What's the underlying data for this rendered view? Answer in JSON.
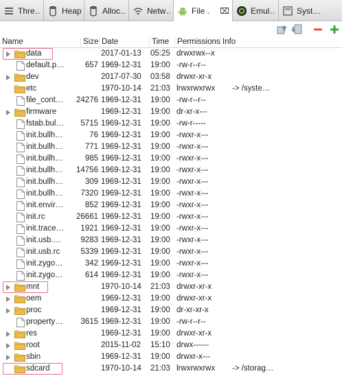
{
  "tabs": [
    {
      "label": "Thre…",
      "icon": "threads-icon"
    },
    {
      "label": "Heap",
      "icon": "heap-icon"
    },
    {
      "label": "Alloc…",
      "icon": "allocation-icon"
    },
    {
      "label": "Netw…",
      "icon": "network-icon"
    },
    {
      "label": "File …",
      "icon": "android-icon",
      "close": "⌧"
    },
    {
      "label": "Emul…",
      "icon": "emulator-icon"
    },
    {
      "label": "Syst…",
      "icon": "system-icon"
    }
  ],
  "header": {
    "name": "Name",
    "size": "Size",
    "date": "Date",
    "time": "Time",
    "permissions": "Permissions",
    "info": "Info"
  },
  "rows": [
    {
      "name": "data",
      "size": "",
      "date": "2017-01-13",
      "time": "05:25",
      "perm": "drwxrwx--x",
      "info": "",
      "type": "folder",
      "expandable": true,
      "highlighted": true
    },
    {
      "name": "default.p…",
      "size": "657",
      "date": "1969-12-31",
      "time": "19:00",
      "perm": "-rw-r--r--",
      "info": "",
      "type": "file"
    },
    {
      "name": "dev",
      "size": "",
      "date": "2017-07-30",
      "time": "03:58",
      "perm": "drwxr-xr-x",
      "info": "",
      "type": "folder",
      "expandable": true
    },
    {
      "name": "etc",
      "size": "",
      "date": "1970-10-14",
      "time": "21:03",
      "perm": "lrwxrwxrwx",
      "info": "-> /syste…",
      "type": "folder",
      "expandable": false
    },
    {
      "name": "file_cont…",
      "size": "24276",
      "date": "1969-12-31",
      "time": "19:00",
      "perm": "-rw-r--r--",
      "info": "",
      "type": "file"
    },
    {
      "name": "firmware",
      "size": "",
      "date": "1969-12-31",
      "time": "19:00",
      "perm": "dr-xr-x---",
      "info": "",
      "type": "folder",
      "expandable": true
    },
    {
      "name": "fstab.bul…",
      "size": "5715",
      "date": "1969-12-31",
      "time": "19:00",
      "perm": "-rw-r-----",
      "info": "",
      "type": "file"
    },
    {
      "name": "init.bullh…",
      "size": "76",
      "date": "1969-12-31",
      "time": "19:00",
      "perm": "-rwxr-x---",
      "info": "",
      "type": "file"
    },
    {
      "name": "init.bullh…",
      "size": "771",
      "date": "1969-12-31",
      "time": "19:00",
      "perm": "-rwxr-x---",
      "info": "",
      "type": "file"
    },
    {
      "name": "init.bullh…",
      "size": "985",
      "date": "1969-12-31",
      "time": "19:00",
      "perm": "-rwxr-x---",
      "info": "",
      "type": "file"
    },
    {
      "name": "init.bullh…",
      "size": "14756",
      "date": "1969-12-31",
      "time": "19:00",
      "perm": "-rwxr-x---",
      "info": "",
      "type": "file"
    },
    {
      "name": "init.bullh…",
      "size": "309",
      "date": "1969-12-31",
      "time": "19:00",
      "perm": "-rwxr-x---",
      "info": "",
      "type": "file"
    },
    {
      "name": "init.bullh…",
      "size": "7320",
      "date": "1969-12-31",
      "time": "19:00",
      "perm": "-rwxr-x---",
      "info": "",
      "type": "file"
    },
    {
      "name": "init.envir…",
      "size": "852",
      "date": "1969-12-31",
      "time": "19:00",
      "perm": "-rwxr-x---",
      "info": "",
      "type": "file"
    },
    {
      "name": "init.rc",
      "size": "26661",
      "date": "1969-12-31",
      "time": "19:00",
      "perm": "-rwxr-x---",
      "info": "",
      "type": "file"
    },
    {
      "name": "init.trace…",
      "size": "1921",
      "date": "1969-12-31",
      "time": "19:00",
      "perm": "-rwxr-x---",
      "info": "",
      "type": "file"
    },
    {
      "name": "init.usb.…",
      "size": "9283",
      "date": "1969-12-31",
      "time": "19:00",
      "perm": "-rwxr-x---",
      "info": "",
      "type": "file"
    },
    {
      "name": "init.usb.rc",
      "size": "5339",
      "date": "1969-12-31",
      "time": "19:00",
      "perm": "-rwxr-x---",
      "info": "",
      "type": "file"
    },
    {
      "name": "init.zygo…",
      "size": "342",
      "date": "1969-12-31",
      "time": "19:00",
      "perm": "-rwxr-x---",
      "info": "",
      "type": "file"
    },
    {
      "name": "init.zygo…",
      "size": "614",
      "date": "1969-12-31",
      "time": "19:00",
      "perm": "-rwxr-x---",
      "info": "",
      "type": "file"
    },
    {
      "name": "mnt",
      "size": "",
      "date": "1970-10-14",
      "time": "21:03",
      "perm": "drwxr-xr-x",
      "info": "",
      "type": "folder",
      "expandable": true,
      "highlighted": true
    },
    {
      "name": "oem",
      "size": "",
      "date": "1969-12-31",
      "time": "19:00",
      "perm": "drwxr-xr-x",
      "info": "",
      "type": "folder",
      "expandable": true
    },
    {
      "name": "proc",
      "size": "",
      "date": "1969-12-31",
      "time": "19:00",
      "perm": "dr-xr-xr-x",
      "info": "",
      "type": "folder",
      "expandable": true
    },
    {
      "name": "property…",
      "size": "3615",
      "date": "1969-12-31",
      "time": "19:00",
      "perm": "-rw-r--r--",
      "info": "",
      "type": "file"
    },
    {
      "name": "res",
      "size": "",
      "date": "1969-12-31",
      "time": "19:00",
      "perm": "drwxr-xr-x",
      "info": "",
      "type": "folder",
      "expandable": true
    },
    {
      "name": "root",
      "size": "",
      "date": "2015-11-02",
      "time": "15:10",
      "perm": "drwx------",
      "info": "",
      "type": "folder",
      "expandable": true
    },
    {
      "name": "sbin",
      "size": "",
      "date": "1969-12-31",
      "time": "19:00",
      "perm": "drwxr-x---",
      "info": "",
      "type": "folder",
      "expandable": true
    },
    {
      "name": "sdcard",
      "size": "",
      "date": "1970-10-14",
      "time": "21:03",
      "perm": "lrwxrwxrwx",
      "info": "-> /storag…",
      "type": "folder",
      "expandable": false,
      "highlighted": true
    }
  ],
  "toolbar": {
    "buttons": [
      {
        "icon": "pull-file-icon"
      },
      {
        "icon": "push-file-icon"
      },
      {
        "icon": "delete-minus-icon",
        "color": "#e05050"
      },
      {
        "icon": "new-folder-plus-icon",
        "color": "#3aa53a"
      }
    ]
  },
  "colors": {
    "highlight": "#f06a8a",
    "folder": "#e9b94a"
  }
}
